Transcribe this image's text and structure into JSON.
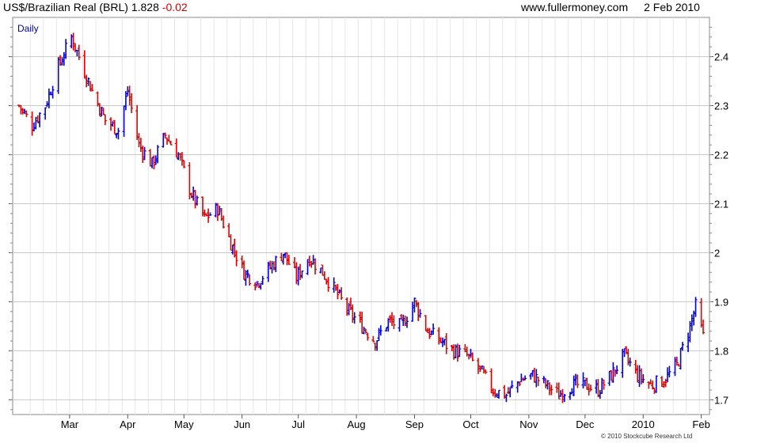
{
  "header": {
    "instrument": "US$/Brazilian Real (BRL)",
    "last": "1.828",
    "change": "-0.02",
    "source": "www.fullermoney.com",
    "date": "2 Feb 2010"
  },
  "chart_data": {
    "type": "ohlc",
    "period_label": "Daily",
    "copyright": "© 2010 Stockcube Research Ltd",
    "ylim": [
      1.67,
      2.48
    ],
    "y_ticks": [
      1.7,
      1.8,
      1.9,
      2.0,
      2.1,
      2.2,
      2.3,
      2.4
    ],
    "y_tick_labels": [
      "1.7",
      "1.8",
      "1.9",
      "2",
      "2.1",
      "2.2",
      "2.3",
      "2.4"
    ],
    "x_range": [
      "2009-02-02",
      "2010-02-02"
    ],
    "month_labels": [
      "Mar",
      "Apr",
      "May",
      "Jun",
      "Jul",
      "Aug",
      "Sep",
      "Oct",
      "Nov",
      "Dec",
      "2010",
      "Feb"
    ],
    "month_dates": [
      "2009-03-01",
      "2009-04-01",
      "2009-05-01",
      "2009-06-01",
      "2009-07-01",
      "2009-08-01",
      "2009-09-01",
      "2009-10-01",
      "2009-11-01",
      "2009-12-01",
      "2010-01-01",
      "2010-02-01"
    ],
    "up_color": "#0000dd",
    "down_color": "#dd0000",
    "grid": true,
    "close_keypoints": [
      [
        "2009-02-02",
        2.3
      ],
      [
        "2009-02-09",
        2.26
      ],
      [
        "2009-02-16",
        2.3
      ],
      [
        "2009-02-23",
        2.38
      ],
      [
        "2009-03-02",
        2.44
      ],
      [
        "2009-03-06",
        2.4
      ],
      [
        "2009-03-13",
        2.33
      ],
      [
        "2009-03-20",
        2.27
      ],
      [
        "2009-03-27",
        2.25
      ],
      [
        "2009-04-01",
        2.33
      ],
      [
        "2009-04-07",
        2.22
      ],
      [
        "2009-04-14",
        2.18
      ],
      [
        "2009-04-21",
        2.24
      ],
      [
        "2009-04-28",
        2.2
      ],
      [
        "2009-05-05",
        2.12
      ],
      [
        "2009-05-12",
        2.07
      ],
      [
        "2009-05-19",
        2.09
      ],
      [
        "2009-05-26",
        2.02
      ],
      [
        "2009-06-02",
        1.96
      ],
      [
        "2009-06-09",
        1.94
      ],
      [
        "2009-06-16",
        1.97
      ],
      [
        "2009-06-23",
        2.0
      ],
      [
        "2009-06-30",
        1.95
      ],
      [
        "2009-07-07",
        1.99
      ],
      [
        "2009-07-14",
        1.96
      ],
      [
        "2009-07-21",
        1.92
      ],
      [
        "2009-07-28",
        1.88
      ],
      [
        "2009-08-04",
        1.85
      ],
      [
        "2009-08-11",
        1.82
      ],
      [
        "2009-08-18",
        1.86
      ],
      [
        "2009-08-25",
        1.85
      ],
      [
        "2009-09-01",
        1.9
      ],
      [
        "2009-09-08",
        1.84
      ],
      [
        "2009-09-15",
        1.82
      ],
      [
        "2009-09-22",
        1.8
      ],
      [
        "2009-09-29",
        1.79
      ],
      [
        "2009-10-06",
        1.76
      ],
      [
        "2009-10-13",
        1.72
      ],
      [
        "2009-10-20",
        1.71
      ],
      [
        "2009-10-27",
        1.74
      ],
      [
        "2009-11-03",
        1.75
      ],
      [
        "2009-11-10",
        1.73
      ],
      [
        "2009-11-17",
        1.71
      ],
      [
        "2009-11-24",
        1.73
      ],
      [
        "2009-12-01",
        1.73
      ],
      [
        "2009-12-08",
        1.72
      ],
      [
        "2009-12-15",
        1.75
      ],
      [
        "2009-12-22",
        1.79
      ],
      [
        "2009-12-29",
        1.75
      ],
      [
        "2010-01-05",
        1.73
      ],
      [
        "2010-01-12",
        1.74
      ],
      [
        "2010-01-19",
        1.77
      ],
      [
        "2010-01-26",
        1.85
      ],
      [
        "2010-01-29",
        1.89
      ],
      [
        "2010-02-02",
        1.828
      ]
    ]
  }
}
